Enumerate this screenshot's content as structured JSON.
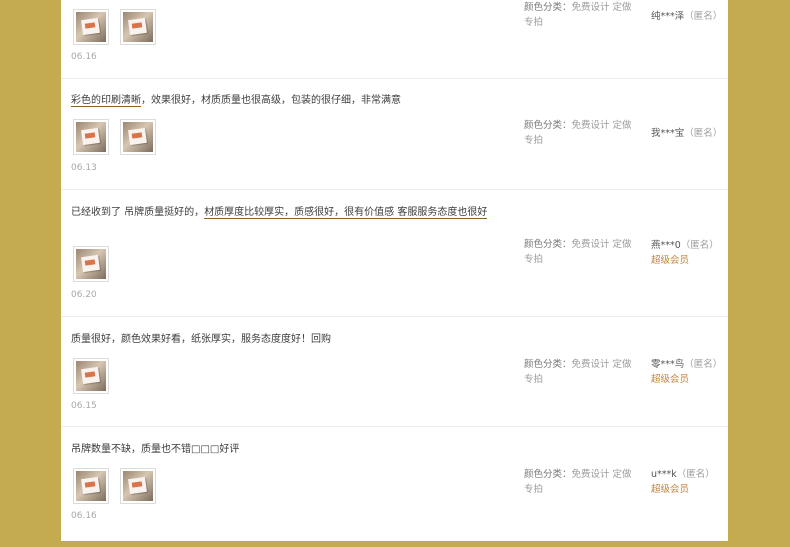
{
  "sku": {
    "key": "颜色分类：",
    "value": "免费设计 定做专拍"
  },
  "reviews": [
    {
      "comment": "",
      "comment_u": "",
      "comment_rest": "",
      "date": "06.16",
      "photos": 2,
      "user": "纯***泽",
      "anon": "（匿名）",
      "vip": ""
    },
    {
      "comment": "",
      "comment_u": "彩色的印刷清晰",
      "comment_rest": "，效果很好，材质质量也很高级，包装的很仔细，非常满意",
      "date": "06.13",
      "photos": 2,
      "user": "我***宝",
      "anon": "（匿名）",
      "vip": ""
    },
    {
      "comment": "已经收到了 吊牌质量挺好的，",
      "comment_u": "材质厚度比较厚实，质感很好，很有价值感 客服服务态度也很好",
      "comment_rest": "",
      "date": "06.20",
      "photos": 1,
      "user": "燕***0",
      "anon": "（匿名）",
      "vip": "超级会员"
    },
    {
      "comment": "质量很好，颜色效果好看，纸张厚实，服务态度度好！回购",
      "comment_u": "",
      "comment_rest": "",
      "date": "06.15",
      "photos": 1,
      "user": "零***鸟",
      "anon": "（匿名）",
      "vip": "超级会员"
    },
    {
      "comment": "吊牌数量不缺，质量也不错□□□好评",
      "comment_u": "",
      "comment_rest": "",
      "date": "06.16",
      "photos": 2,
      "user": "u***k",
      "anon": "（匿名）",
      "vip": "超级会员"
    }
  ]
}
